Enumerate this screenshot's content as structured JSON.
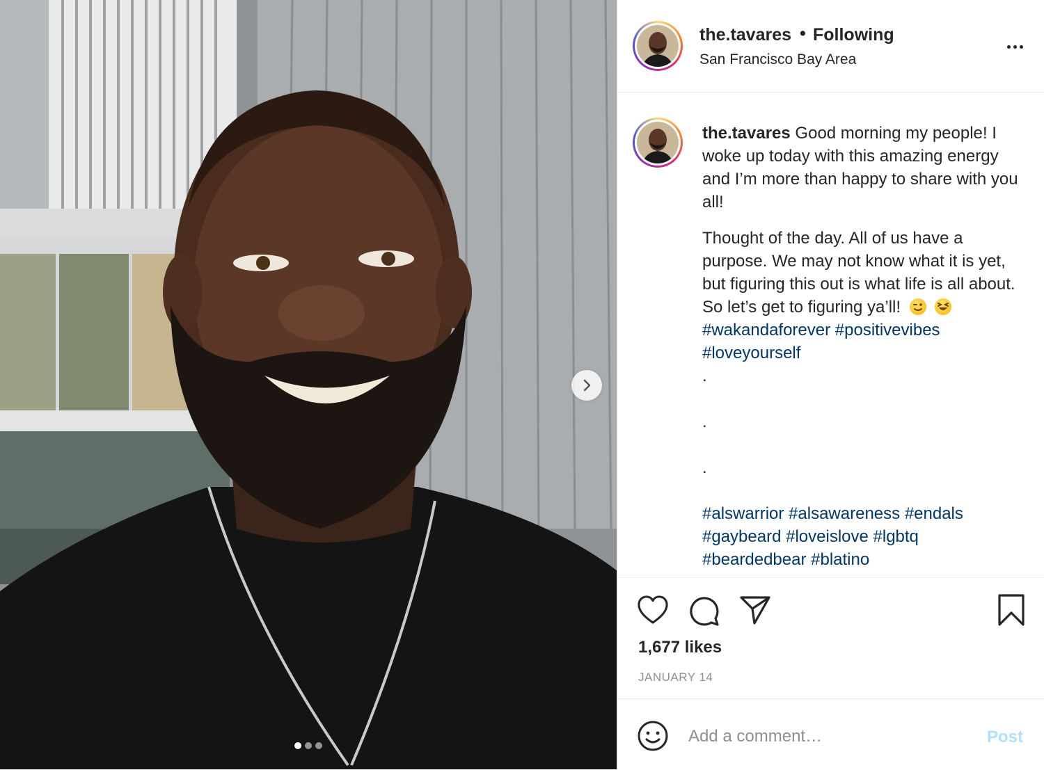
{
  "post": {
    "username": "the.tavares",
    "separator": "•",
    "follow_status": "Following",
    "location": "San Francisco Bay Area",
    "more_icon": "more-options-icon"
  },
  "media": {
    "carousel_count": 3,
    "carousel_active": 1,
    "next_icon": "chevron-right-icon"
  },
  "caption": {
    "username": "the.tavares",
    "para1": "Good morning my people! I woke up today with this amazing energy and I’m more than happy to share with you all!",
    "para2": "Thought of the day. All of us have a purpose. We may not know what it is yet, but figuring this out is what life is all about. So let’s get to figuring ya’ll!",
    "emojis": [
      "😉",
      "😆"
    ],
    "hashtags1": [
      "#wakandaforever",
      "#positivevibes",
      "#loveyourself"
    ],
    "dot": ".",
    "hashtags2": [
      "#alswarrior",
      "#alsawareness",
      "#endals",
      "#gaybeard",
      "#loveislove",
      "#lgbtq",
      "#beardedbear",
      "#blatino"
    ]
  },
  "actions": {
    "icons": [
      "heart-icon",
      "comment-icon",
      "share-icon",
      "bookmark-icon"
    ],
    "likes": "1,677 likes",
    "date": "JANUARY 14"
  },
  "comment_box": {
    "placeholder": "Add a comment…",
    "post_label": "Post",
    "emoji_icon": "smiley-icon"
  },
  "colors": {
    "hashtag": "#00376b",
    "post_button_disabled": "#b2dffc",
    "muted": "#8e8e8e"
  }
}
